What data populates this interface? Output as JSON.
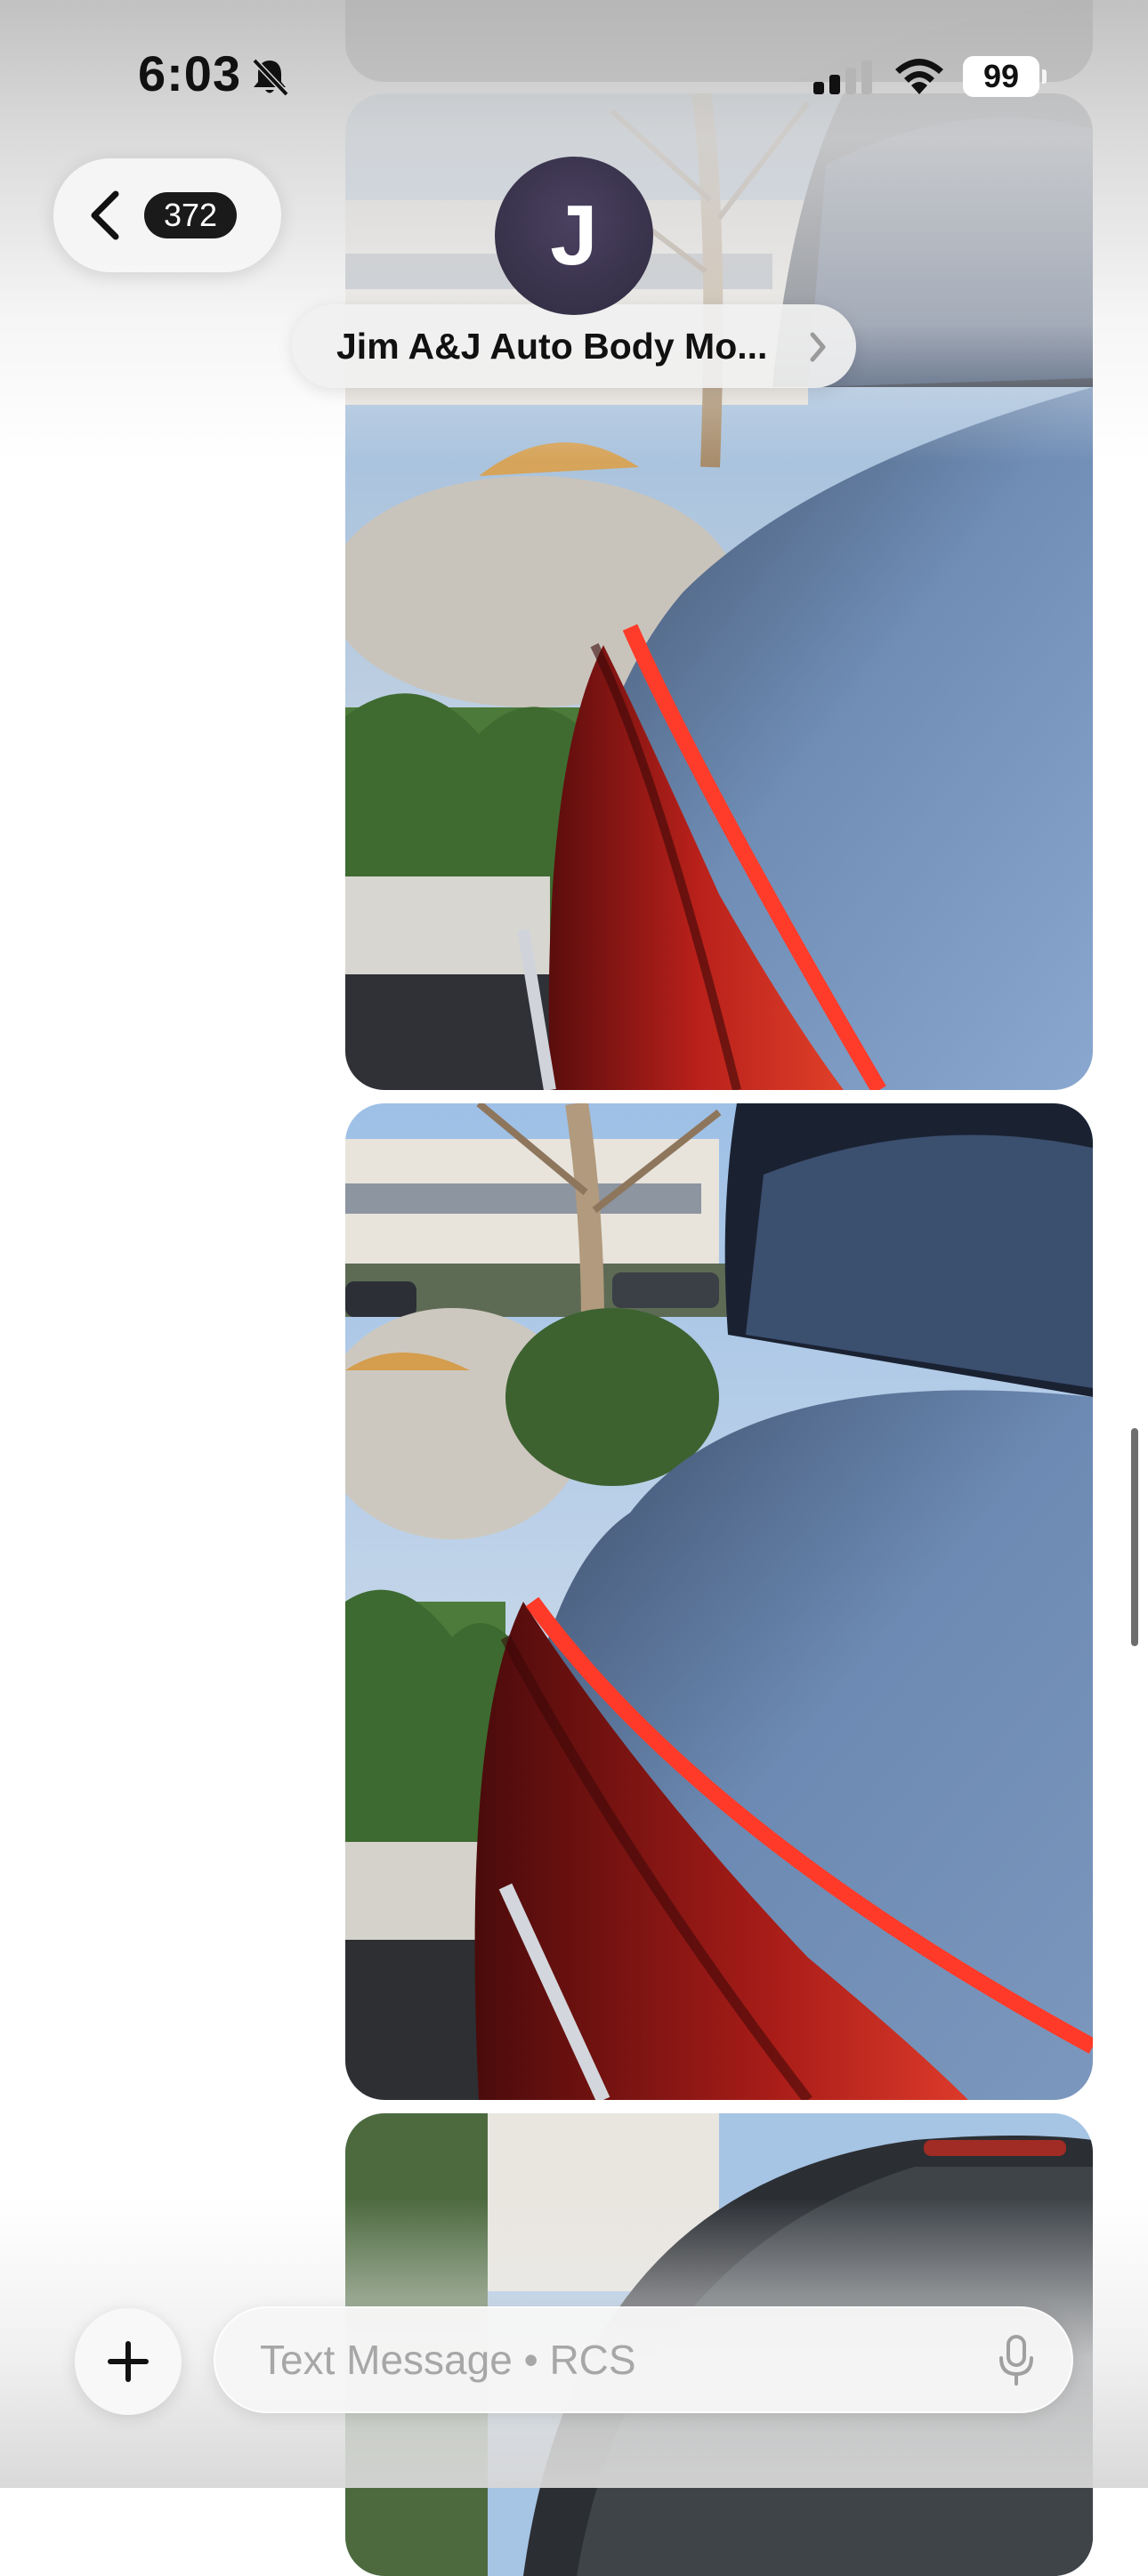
{
  "status_bar": {
    "time": "6:03",
    "battery": "99",
    "icons": [
      "bell-slash-icon",
      "cellular-signal-icon",
      "wifi-icon",
      "battery-icon"
    ]
  },
  "nav": {
    "back_count": "372",
    "back_icon": "chevron-left-icon"
  },
  "contact": {
    "initial": "J",
    "name": "Jim A&J Auto Body Mo...",
    "avatar_color": "#3a3350"
  },
  "messages": {
    "photos": [
      "car-photo",
      "car-photo",
      "car-photo",
      "car-photo"
    ]
  },
  "composer": {
    "placeholder": "Text Message • RCS",
    "add_icon": "plus-icon",
    "mic_icon": "microphone-icon"
  }
}
